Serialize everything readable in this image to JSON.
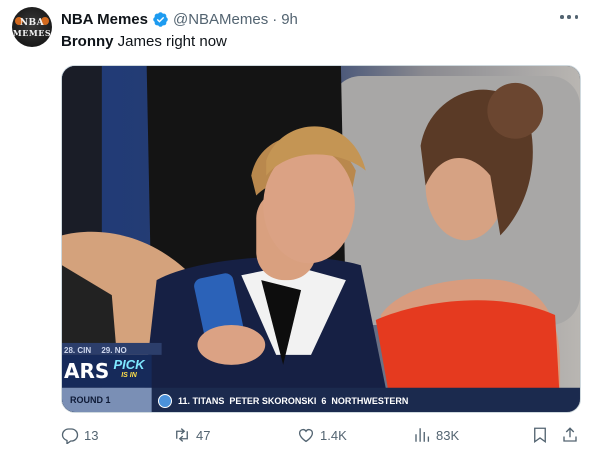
{
  "tweet": {
    "author_name": "NBA Memes",
    "handle": "@NBAMemes",
    "separator": "·",
    "time": "9h",
    "avatar_text_top": "NBA",
    "avatar_text_bottom": "MEMES",
    "text_bold": "Bronny",
    "text_rest": " James right now"
  },
  "media": {
    "scoreboard_left": "28. CIN",
    "scoreboard_left2": "29. NO",
    "team_abbr": "ARS",
    "pick_text": "PICK",
    "pick_sub": "IS IN",
    "round": "ROUND 1",
    "pick_line": "11. TITANS  PETER SKORONSKI  6  NORTHWESTERN"
  },
  "actions": {
    "replies": "13",
    "reposts": "47",
    "likes": "1.4K",
    "views": "83K"
  },
  "colors": {
    "verified": "#1d9bf0",
    "secondary_text": "#536471",
    "border": "#cfd9de"
  },
  "icons": [
    "more-icon",
    "verified-badge-icon",
    "reply-icon",
    "repost-icon",
    "like-icon",
    "views-icon",
    "bookmark-icon",
    "share-icon"
  ]
}
